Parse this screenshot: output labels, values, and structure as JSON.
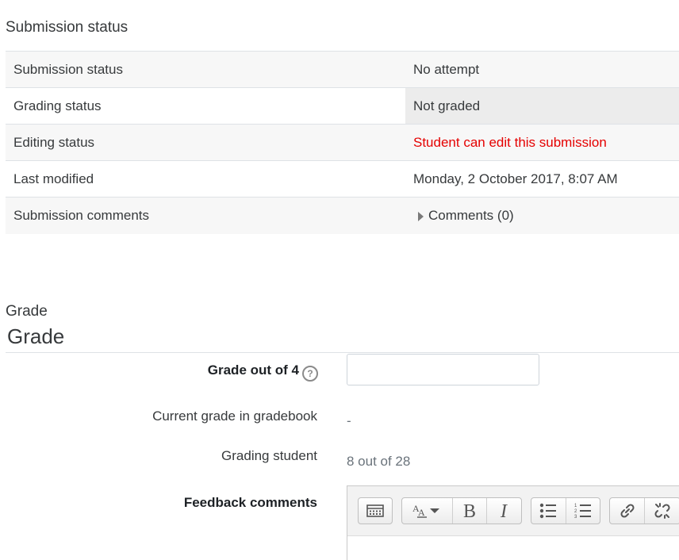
{
  "submission_section": {
    "heading": "Submission status",
    "rows": [
      {
        "label": "Submission status",
        "value": "No attempt"
      },
      {
        "label": "Grading status",
        "value": "Not graded"
      },
      {
        "label": "Editing status",
        "value": "Student can edit this submission"
      },
      {
        "label": "Last modified",
        "value": "Monday, 2 October 2017, 8:07 AM"
      },
      {
        "label": "Submission comments",
        "value": "Comments (0)"
      }
    ]
  },
  "grade_section": {
    "legend": "Grade",
    "title": "Grade",
    "grade_out_of_label": "Grade out of 4",
    "grade_input_value": "",
    "current_grade_label": "Current grade in gradebook",
    "current_grade_value": "-",
    "grading_student_label": "Grading student",
    "grading_student_value": "8 out of 28",
    "feedback_label": "Feedback comments"
  },
  "editor_toolbar": {
    "buttons": [
      "toolbar-toggle-icon",
      "font-style-icon",
      "bold-icon",
      "italic-icon",
      "unordered-list-icon",
      "ordered-list-icon",
      "link-icon",
      "unlink-icon"
    ]
  },
  "colors": {
    "editing_status_text": "#e50000",
    "grading_status_bg": "#ececec"
  }
}
